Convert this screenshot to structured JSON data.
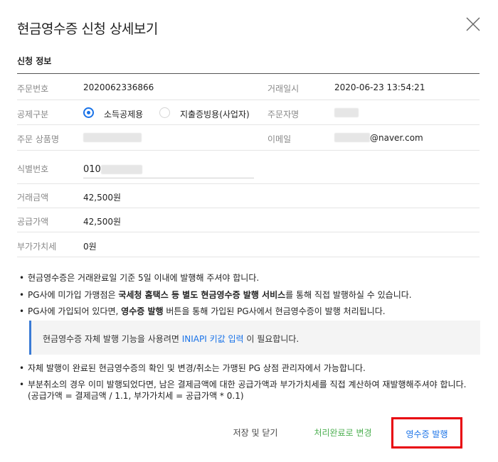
{
  "modal": {
    "title": "현금영수증 신청 상세보기"
  },
  "section": {
    "title": "신청 정보"
  },
  "fields": {
    "order_no_label": "주문번호",
    "order_no": "2020062336866",
    "trade_date_label": "거래일시",
    "trade_date": "2020-06-23 13:54:21",
    "deduction_label": "공제구분",
    "deduction_options": [
      "소득공제용",
      "지출증빙용(사업자)"
    ],
    "deduction_selected": "소득공제용",
    "orderer_label": "주문자명",
    "product_label": "주문 상품명",
    "email_label": "이메일",
    "email_suffix": "@naver.com",
    "id_label": "식별번호",
    "id_value": "010",
    "amount_label": "거래금액",
    "amount": "42,500원",
    "supply_label": "공급가액",
    "supply": "42,500원",
    "vat_label": "부가가치세",
    "vat": "0원"
  },
  "notices": {
    "n1": "현금영수증은 거래완료일 기준 5일 이내에 발행해 주셔야 합니다.",
    "n2_pre": "PG사에 미가입 가맹점은 ",
    "n2_bold": "국세청 홈택스 등 별도 현금영수증 발행 서비스",
    "n2_post": "를 통해 직접 발행하실 수 있습니다.",
    "n3_pre": "PG사에 가입되어 있다면, ",
    "n3_bold": "영수증 발행",
    "n3_post": " 버튼을 통해 가입된 PG사에서 현금영수증이 발행 처리됩니다.",
    "info_pre": "현금영수증 자체 발행 기능을 사용려면 ",
    "info_link": "INIAPI 키값 입력",
    "info_post": " 이 필요합니다.",
    "n4": "자체 발행이 완료된 현금영수증의 확인 및 변경/취소는 가맹된 PG 상점 관리자에서 가능합니다.",
    "n5_line1": "부분취소의 경우 이미 발행되었다면, 남은 결제금액에 대한 공급가액과 부가가치세를 직접 계산하여 재발행해주셔야 합니다.",
    "n5_line2": "(공급가액 = 결제금액 / 1.1, 부가가치세 = 공급가액 * 0.1)"
  },
  "buttons": {
    "save_close": "저장 및 닫기",
    "mark_done": "처리완료로 변경",
    "issue_receipt": "영수증 발행"
  },
  "colors": {
    "accent": "#1a73e8",
    "done": "#4caf50",
    "highlight": "#e8000b"
  }
}
